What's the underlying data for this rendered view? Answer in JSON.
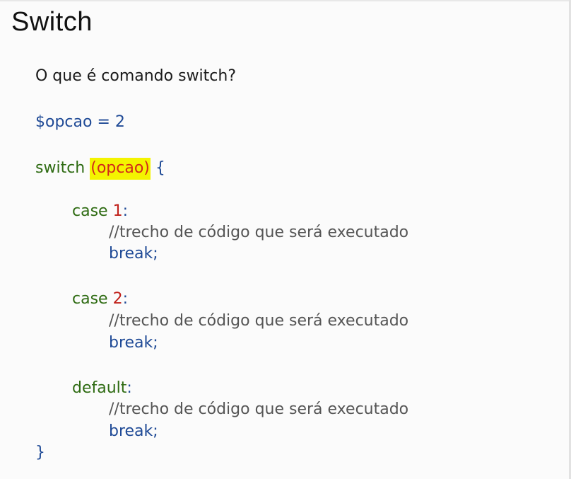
{
  "title": "Switch",
  "question": "O que é comando switch?",
  "assignment": "$opcao = 2",
  "switch_stmt": {
    "keyword": "switch",
    "expr": "(opcao)",
    "open_brace": "{"
  },
  "cases": [
    {
      "keyword": "case",
      "value": "1",
      "colon": ":",
      "comment": "//trecho de código que será executado",
      "break": "break;"
    },
    {
      "keyword": "case",
      "value": "2",
      "colon": ":",
      "comment": "//trecho de código que será executado",
      "break": "break;"
    }
  ],
  "default_block": {
    "keyword": "default",
    "colon": ":",
    "comment": "//trecho de código que será executado",
    "break": "break;"
  },
  "close_brace": "}",
  "colors": {
    "keyword": "#2e6b12",
    "number": "#c0201a",
    "variable": "#1f4a96",
    "highlight": "#f4f400"
  }
}
